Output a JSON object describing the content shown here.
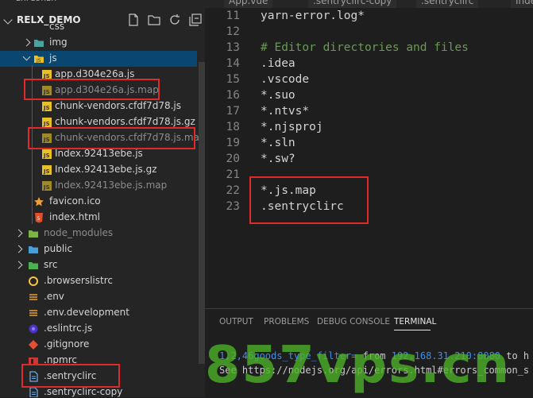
{
  "sidebar": {
    "title": "EXPLORER",
    "project": "RELX_DEMO",
    "items": [
      {
        "label": "css",
        "icon": "folder-icon",
        "dim": false
      },
      {
        "label": "img",
        "icon": "folder-icon",
        "dim": false
      },
      {
        "label": "js",
        "icon": "folder-icon",
        "dim": false
      },
      {
        "label": "app.d304e26a.js",
        "icon": "js-file-icon",
        "dim": false
      },
      {
        "label": "app.d304e26a.js.map",
        "icon": "js-file-icon",
        "dim": true
      },
      {
        "label": "chunk-vendors.cfdf7d78.js",
        "icon": "js-file-icon",
        "dim": false
      },
      {
        "label": "chunk-vendors.cfdf7d78.js.gz",
        "icon": "js-file-icon",
        "dim": false
      },
      {
        "label": "chunk-vendors.cfdf7d78.js.map",
        "icon": "js-file-icon",
        "dim": true
      },
      {
        "label": "Index.92413ebe.js",
        "icon": "js-file-icon",
        "dim": false
      },
      {
        "label": "Index.92413ebe.js.gz",
        "icon": "js-file-icon",
        "dim": false
      },
      {
        "label": "Index.92413ebe.js.map",
        "icon": "js-file-icon",
        "dim": true
      },
      {
        "label": "favicon.ico",
        "icon": "star-icon",
        "dim": false
      },
      {
        "label": "index.html",
        "icon": "html5-icon",
        "dim": false
      },
      {
        "label": "node_modules",
        "icon": "folder-icon",
        "dim": true
      },
      {
        "label": "public",
        "icon": "folder-icon",
        "dim": false
      },
      {
        "label": "src",
        "icon": "folder-icon",
        "dim": false
      },
      {
        "label": ".browserslistrc",
        "icon": "circle-icon",
        "dim": false
      },
      {
        "label": ".env",
        "icon": "settings-lines-icon",
        "dim": false
      },
      {
        "label": ".env.development",
        "icon": "settings-lines-icon",
        "dim": false
      },
      {
        "label": ".eslintrc.js",
        "icon": "eslint-icon",
        "dim": false
      },
      {
        "label": ".gitignore",
        "icon": "git-icon",
        "dim": false
      },
      {
        "label": ".npmrc",
        "icon": "npm-icon",
        "dim": false
      },
      {
        "label": ".sentryclirc",
        "icon": "file-icon",
        "dim": false
      },
      {
        "label": ".sentryclirc-copy",
        "icon": "file-icon",
        "dim": false
      }
    ]
  },
  "tabs": [
    "App.vue",
    ".sentryclirc-copy",
    ".sentryclirc",
    "Index"
  ],
  "editor": {
    "lines": [
      {
        "n": "11",
        "text": "yarn-error.log*",
        "comment": false
      },
      {
        "n": "12",
        "text": "",
        "comment": false
      },
      {
        "n": "13",
        "text": "# Editor directories and files",
        "comment": true
      },
      {
        "n": "14",
        "text": ".idea",
        "comment": false
      },
      {
        "n": "15",
        "text": ".vscode",
        "comment": false
      },
      {
        "n": "16",
        "text": "*.suo",
        "comment": false
      },
      {
        "n": "17",
        "text": "*.ntvs*",
        "comment": false
      },
      {
        "n": "18",
        "text": "*.njsproj",
        "comment": false
      },
      {
        "n": "19",
        "text": "*.sln",
        "comment": false
      },
      {
        "n": "20",
        "text": "*.sw?",
        "comment": false
      },
      {
        "n": "21",
        "text": "",
        "comment": false
      },
      {
        "n": "22",
        "text": "*.js.map",
        "comment": false
      },
      {
        "n": "23",
        "text": ".sentryclirc",
        "comment": false
      }
    ]
  },
  "panel": {
    "tabs": [
      "OUTPUT",
      "PROBLEMS",
      "DEBUG CONSOLE",
      "TERMINAL"
    ],
    "active_tab": "TERMINAL",
    "terminal": {
      "line1_prefix": "1,2,46goods_type_filter=",
      "line1_mid": " from ",
      "line1_ip": "192.168.31.210:8080",
      "line1_end": " to h",
      "line2": "See https://nodejs.org/api/errors.html#errors_common_s"
    }
  },
  "watermark": "857vps.cn",
  "colors": {
    "highlight": "#e02a2a",
    "js_icon": "#e8c02a",
    "folder": "#4a9fd8",
    "selected": "#094771"
  }
}
